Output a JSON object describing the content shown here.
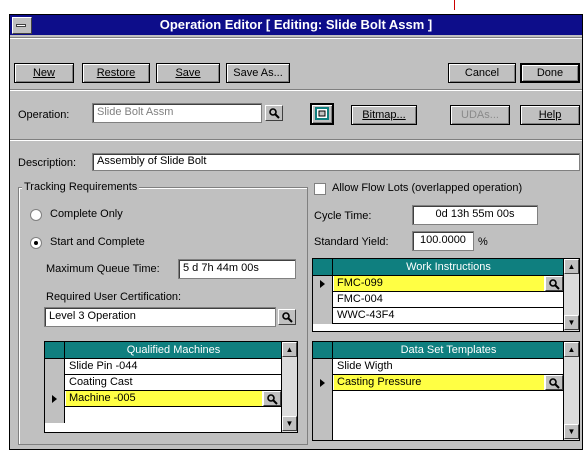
{
  "window": {
    "title": "Operation Editor [ Editing: Slide Bolt Assm ]"
  },
  "toolbar": {
    "new": "New",
    "restore": "Restore",
    "save": "Save",
    "save_as": "Save As...",
    "cancel": "Cancel",
    "done": "Done"
  },
  "operation": {
    "label": "Operation:",
    "value": "Slide Bolt Assm",
    "bitmap": "Bitmap...",
    "udas": "UDAs...",
    "help": "Help"
  },
  "description": {
    "label": "Description:",
    "value": "Assembly of Slide Bolt"
  },
  "tracking": {
    "group_label": "Tracking Requirements",
    "complete_only": "Complete Only",
    "start_and_complete": "Start and Complete",
    "selected": "start_and_complete",
    "max_queue_label": "Maximum Queue Time:",
    "max_queue_value": "5  d  7h 44m 00s",
    "cert_label": "Required User Certification:",
    "cert_value": "Level 3 Operation"
  },
  "machines": {
    "header": "Qualified Machines",
    "rows": [
      "Slide Pin -044",
      "Coating Cast",
      "Machine -005",
      ""
    ],
    "current_row": 2
  },
  "flow": {
    "allow_label": "Allow Flow Lots (overlapped operation)",
    "checked": false
  },
  "cycle": {
    "label": "Cycle Time:",
    "value": "0d 13h 55m 00s"
  },
  "yield": {
    "label": "Standard Yield:",
    "value": "100.0000",
    "unit": "%"
  },
  "work_instructions": {
    "header": "Work Instructions",
    "rows": [
      "FMC-099",
      "FMC-004",
      "WWC-43F4"
    ],
    "current_row": 0
  },
  "data_sets": {
    "header": "Data Set Templates",
    "rows": [
      "Slide Wigth",
      "Casting Pressure",
      "",
      ""
    ],
    "current_row": 1
  },
  "colors": {
    "title_bg": "#0d0d8a",
    "grid_header": "#0f7f7f",
    "highlight": "#ffff44"
  }
}
